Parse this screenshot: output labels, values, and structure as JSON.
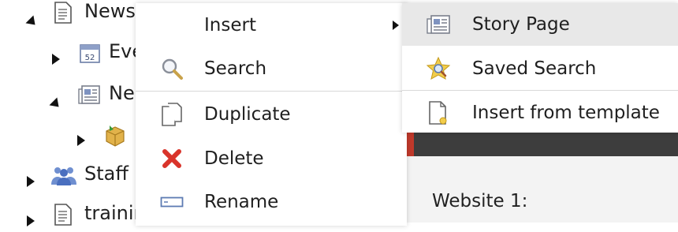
{
  "tree": {
    "items": [
      {
        "label": "News",
        "icon": "document-icon",
        "expanded": true
      },
      {
        "label": "Eve",
        "icon": "calendar-icon",
        "expanded": false
      },
      {
        "label": "Ne",
        "icon": "newspaper-icon",
        "expanded": true
      },
      {
        "label": "",
        "icon": "package-icon",
        "expanded": false
      },
      {
        "label": "Staff D",
        "icon": "people-icon",
        "expanded": false
      },
      {
        "label": "trainir",
        "icon": "document-icon",
        "expanded": false
      }
    ]
  },
  "context_menu": {
    "items": [
      {
        "label": "Insert",
        "icon": "none",
        "has_submenu": true
      },
      {
        "label": "Search",
        "icon": "magnifier-icon"
      },
      {
        "label": "Duplicate",
        "icon": "duplicate-icon"
      },
      {
        "label": "Delete",
        "icon": "delete-x-icon"
      },
      {
        "label": "Rename",
        "icon": "rename-icon"
      }
    ]
  },
  "submenu": {
    "items": [
      {
        "label": "Story Page",
        "icon": "newspaper-icon",
        "highlighted": true
      },
      {
        "label": "Saved Search",
        "icon": "star-search-icon"
      },
      {
        "label": "Insert from template",
        "icon": "template-icon"
      }
    ]
  },
  "right_panel": {
    "website_label": "Website 1:"
  },
  "colors": {
    "highlight": "#e8e8e8",
    "delete_red": "#d9342b",
    "panel_dark": "#3d3d3d",
    "accent_red": "#c0392b"
  }
}
